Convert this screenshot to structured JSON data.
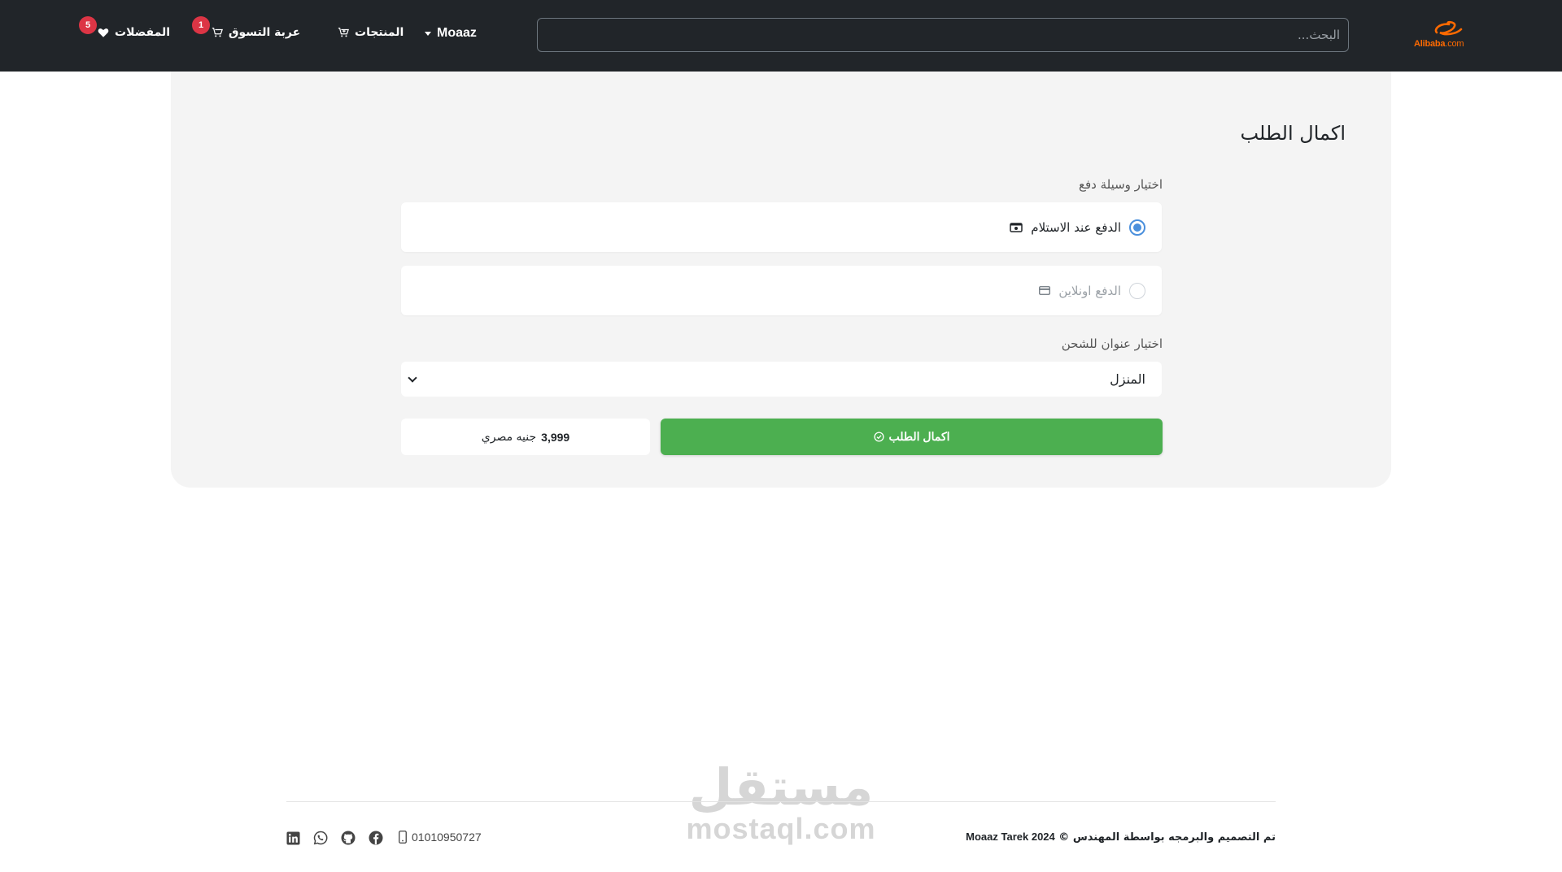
{
  "navbar": {
    "logo_text": "Alibaba",
    "logo_suffix": ".com",
    "search_placeholder": "البحث...",
    "user_name": "Moaaz",
    "products_label": "المنتجات",
    "cart_label": "عربة التسوق",
    "cart_count": "1",
    "favorites_label": "المفضلات",
    "favorites_count": "5"
  },
  "checkout": {
    "title": "اكمال الطلب",
    "payment_label": "اختيار وسيلة دفع",
    "payment_options": [
      {
        "label": "الدفع عند الاستلام",
        "icon": "cash-icon",
        "selected": true
      },
      {
        "label": "الدفع اونلاين",
        "icon": "credit-card-icon",
        "selected": false
      }
    ],
    "address_label": "اختيار عنوان للشحن",
    "address_selected": "المنزل",
    "submit_label": "اكمال الطلب",
    "total_amount": "3,999",
    "total_currency": "جنيه مصري"
  },
  "footer": {
    "copyright_prefix": "تم التصميم والبرمجه بواسطة المهندس ©",
    "copyright_year_name": "Moaaz Tarek 2024",
    "phone": "01010950727",
    "social": [
      "facebook-icon",
      "github-icon",
      "whatsapp-icon",
      "linkedin-icon"
    ]
  },
  "watermark": {
    "arabic": "مستقل",
    "latin": "mostaql.com"
  },
  "colors": {
    "navbar_bg": "#212529",
    "accent_green": "#4caf50",
    "badge_red": "#dc3545",
    "radio_blue": "#4a8fdc",
    "logo_orange": "#ff6a00"
  }
}
